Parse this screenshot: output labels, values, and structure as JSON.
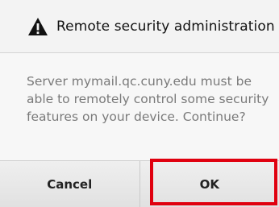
{
  "dialog": {
    "title": "Remote security administration",
    "title_icon": "warning-triangle-icon",
    "message": "Server mymail.qc.cuny.edu must be able to remotely control some security features on your device. Continue?",
    "buttons": {
      "cancel_label": "Cancel",
      "ok_label": "OK"
    },
    "highlight_color": "#e0000f"
  }
}
